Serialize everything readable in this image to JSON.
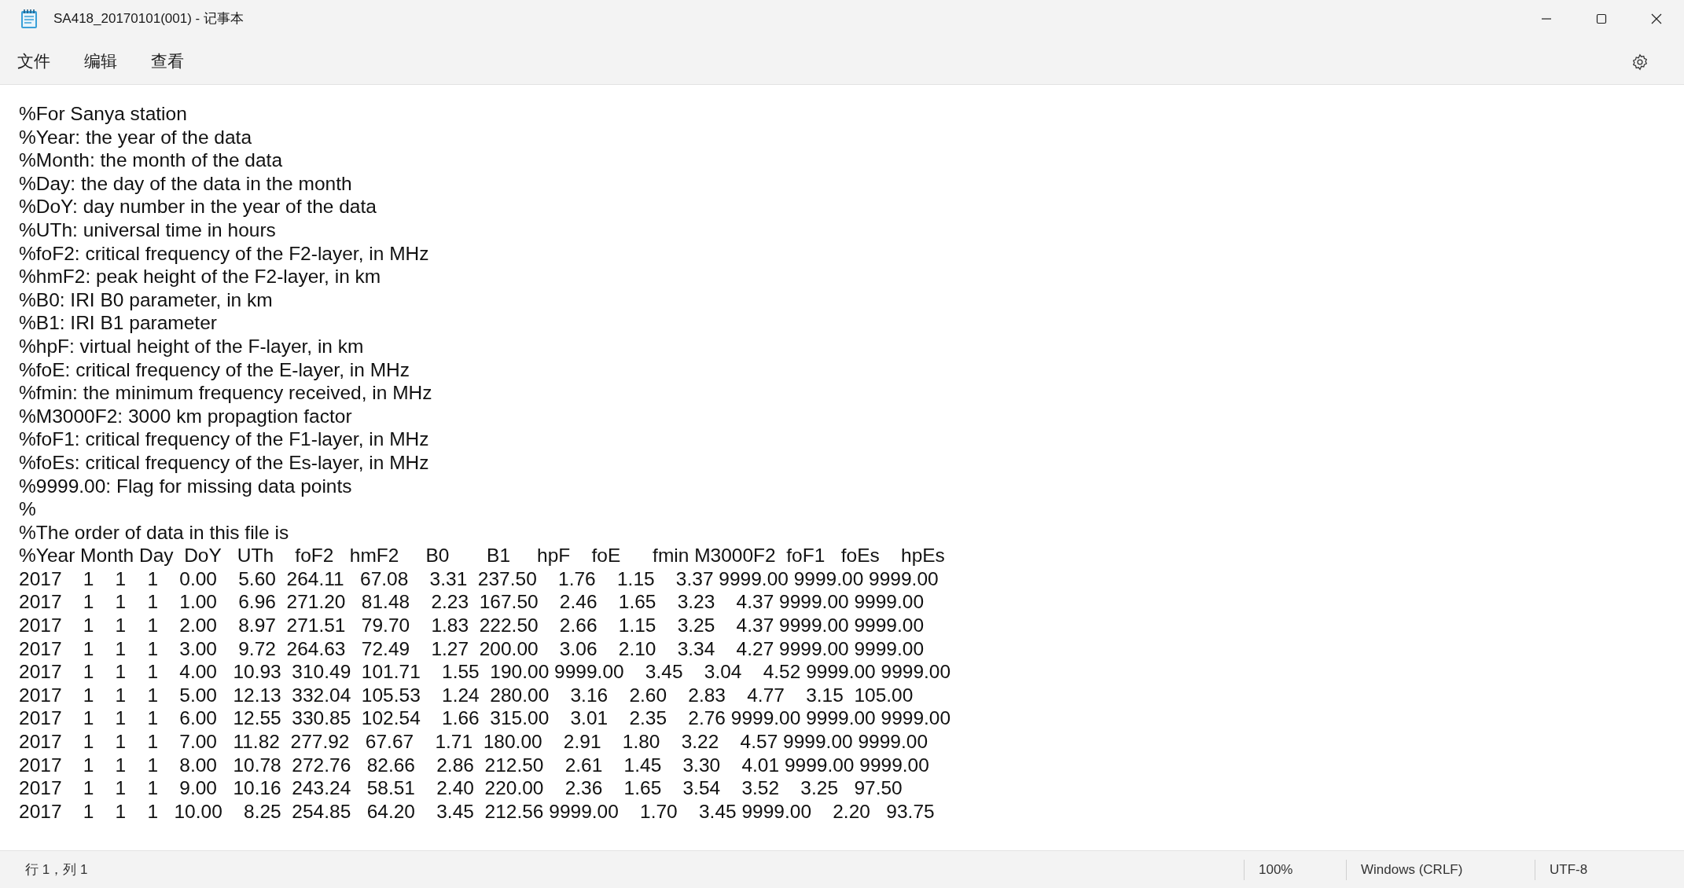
{
  "window": {
    "title": "SA418_20170101(001) - 记事本"
  },
  "menu": [
    {
      "label": "文件"
    },
    {
      "label": "编辑"
    },
    {
      "label": "查看"
    }
  ],
  "lines": [
    "%For Sanya station",
    "%Year: the year of the data",
    "%Month: the month of the data",
    "%Day: the day of the data in the month",
    "%DoY: day number in the year of the data",
    "%UTh: universal time in hours",
    "%foF2: critical frequency of the F2-layer, in MHz",
    "%hmF2: peak height of the F2-layer, in km",
    "%B0: IRI B0 parameter, in km",
    "%B1: IRI B1 parameter",
    "%hpF: virtual height of the F-layer, in km",
    "%foE: critical frequency of the E-layer, in MHz",
    "%fmin: the minimum frequency received, in MHz",
    "%M3000F2: 3000 km propagtion factor",
    "%foF1: critical frequency of the F1-layer, in MHz",
    "%foEs: critical frequency of the Es-layer, in MHz",
    "%9999.00: Flag for missing data points",
    "%",
    "%The order of data in this file is",
    "%Year Month Day  DoY   UTh    foF2   hmF2     B0       B1     hpF    foE      fmin M3000F2  foF1   foEs    hpEs",
    "2017    1    1    1    0.00    5.60  264.11   67.08    3.31  237.50    1.76    1.15    3.37 9999.00 9999.00 9999.00",
    "2017    1    1    1    1.00    6.96  271.20   81.48    2.23  167.50    2.46    1.65    3.23    4.37 9999.00 9999.00",
    "2017    1    1    1    2.00    8.97  271.51   79.70    1.83  222.50    2.66    1.15    3.25    4.37 9999.00 9999.00",
    "2017    1    1    1    3.00    9.72  264.63   72.49    1.27  200.00    3.06    2.10    3.34    4.27 9999.00 9999.00",
    "2017    1    1    1    4.00   10.93  310.49  101.71    1.55  190.00 9999.00    3.45    3.04    4.52 9999.00 9999.00",
    "2017    1    1    1    5.00   12.13  332.04  105.53    1.24  280.00    3.16    2.60    2.83    4.77    3.15  105.00",
    "2017    1    1    1    6.00   12.55  330.85  102.54    1.66  315.00    3.01    2.35    2.76 9999.00 9999.00 9999.00",
    "2017    1    1    1    7.00   11.82  277.92   67.67    1.71  180.00    2.91    1.80    3.22    4.57 9999.00 9999.00",
    "2017    1    1    1    8.00   10.78  272.76   82.66    2.86  212.50    2.61    1.45    3.30    4.01 9999.00 9999.00",
    "2017    1    1    1    9.00   10.16  243.24   58.51    2.40  220.00    2.36    1.65    3.54    3.52    3.25   97.50",
    "2017    1    1    1   10.00    8.25  254.85   64.20    3.45  212.56 9999.00    1.70    3.45 9999.00    2.20   93.75"
  ],
  "status_bar": {
    "position": "行 1，列 1",
    "zoom": "100%",
    "line_ending": "Windows (CRLF)",
    "encoding": "UTF-8"
  }
}
